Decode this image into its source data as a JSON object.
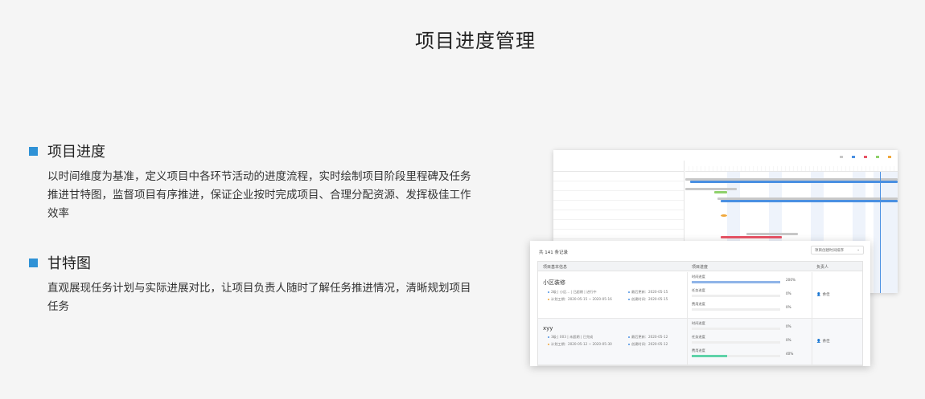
{
  "page": {
    "title": "项目进度管理"
  },
  "features": [
    {
      "title": "项目进度",
      "desc": "以时间维度为基准，定义项目中各环节活动的进度流程，实时绘制项目阶段里程碑及任务推进甘特图，监督项目有序推进，保证企业按时完成项目、合理分配资源、发挥极佳工作效率"
    },
    {
      "title": "甘特图",
      "desc": "直观展现任务计划与实际进展对比，让项目负责人随时了解任务推进情况，清晰规划项目任务"
    }
  ],
  "colors": {
    "accent": "#2f92d6",
    "bar_blue": "#4a90e2",
    "bar_gray": "#c8c8c8",
    "bar_green": "#8fd16b",
    "bar_red": "#e85466",
    "bar_orange": "#f0a83c",
    "progress_blue": "#8fb4e8",
    "progress_green": "#5fd3a9"
  },
  "table": {
    "count": "共 141 条记录",
    "sort_label": "项目创建时间排序",
    "headers": {
      "basic": "项目基本信息",
      "progress": "项目进度",
      "owner": "负责人"
    },
    "rows": [
      {
        "name": "小区装修",
        "line1": "2级  | 小区...  | 已超期  | 进行中",
        "line2": "计划工期：2020-05-15 ~ 2020-05-16",
        "updated": "最后更新：2020-05-15",
        "created": "创建时间：2020-05-15",
        "owner": "余佳",
        "progress": [
          {
            "label": "时间进度",
            "value": "200%",
            "fill": 1.0
          },
          {
            "label": "任务进度",
            "value": "0%",
            "fill": 0
          },
          {
            "label": "费用进度",
            "value": "0%",
            "fill": 0
          }
        ]
      },
      {
        "name": "xyy",
        "line1": "3级  | 003  | 未超期  | 已完成",
        "line2": "计划工期：2020-05-12 ~ 2020-05-30",
        "updated": "最后更新：2020-05-12",
        "created": "创建时间：2020-05-12",
        "owner": "余佳",
        "progress": [
          {
            "label": "时间进度",
            "value": "0%",
            "fill": 0
          },
          {
            "label": "任务进度",
            "value": "0%",
            "fill": 0
          },
          {
            "label": "费用进度",
            "value": "40%",
            "fill": 0.4
          }
        ]
      }
    ]
  }
}
